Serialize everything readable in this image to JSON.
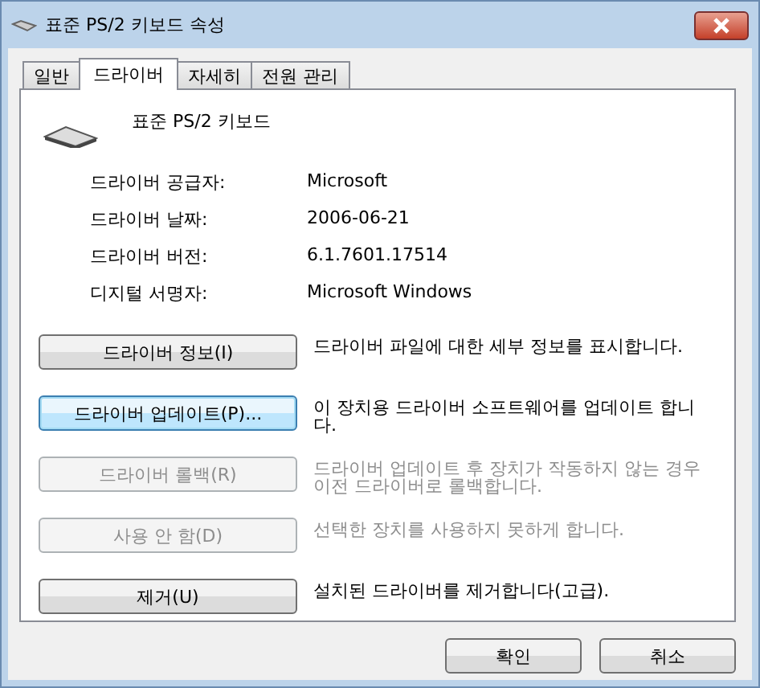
{
  "window": {
    "title": "표준 PS/2 키보드 속성"
  },
  "tabs": [
    {
      "label": "일반",
      "selected": false
    },
    {
      "label": "드라이버",
      "selected": true
    },
    {
      "label": "자세히",
      "selected": false
    },
    {
      "label": "전원 관리",
      "selected": false
    }
  ],
  "device": {
    "name": "표준 PS/2 키보드"
  },
  "details": [
    {
      "label": "드라이버 공급자:",
      "value": "Microsoft"
    },
    {
      "label": "드라이버 날짜:",
      "value": "2006-06-21"
    },
    {
      "label": "드라이버 버전:",
      "value": "6.1.7601.17514"
    },
    {
      "label": "디지털 서명자:",
      "value": "Microsoft Windows"
    }
  ],
  "actions": [
    {
      "button": "드라이버 정보(I)",
      "description": "드라이버 파일에 대한 세부 정보를 표시합니다.",
      "disabled": false,
      "focused": false
    },
    {
      "button": "드라이버 업데이트(P)...",
      "description": "이 장치용 드라이버 소프트웨어를 업데이트 합니다.",
      "disabled": false,
      "focused": true
    },
    {
      "button": "드라이버 롤백(R)",
      "description": "드라이버 업데이트 후 장치가 작동하지 않는 경우 이전 드라이버로 롤백합니다.",
      "disabled": true,
      "focused": false
    },
    {
      "button": "사용 안 함(D)",
      "description": "선택한 장치를 사용하지 못하게 합니다.",
      "disabled": true,
      "focused": false
    },
    {
      "button": "제거(U)",
      "description": "설치된 드라이버를 제거합니다(고급).",
      "disabled": false,
      "focused": false
    }
  ],
  "footer_buttons": [
    "확인",
    "취소"
  ]
}
